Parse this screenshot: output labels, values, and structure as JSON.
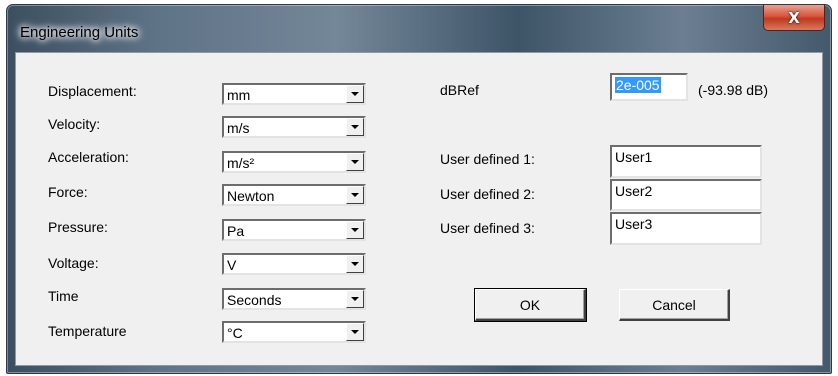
{
  "window": {
    "title": "Engineering Units",
    "close_glyph": "X"
  },
  "units": [
    {
      "label": "Displacement:",
      "value": "mm"
    },
    {
      "label": "Velocity:",
      "value": "m/s"
    },
    {
      "label": "Acceleration:",
      "value": "m/s²"
    },
    {
      "label": "Force:",
      "value": "Newton"
    },
    {
      "label": "Pressure:",
      "value": "Pa"
    },
    {
      "label": "Voltage:",
      "value": "V"
    },
    {
      "label": "Time",
      "value": "Seconds"
    },
    {
      "label": "Temperature",
      "value": "°C"
    }
  ],
  "dbref": {
    "label": "dBRef",
    "value": "2e-005",
    "db_readout": "(-93.98 dB)"
  },
  "user_defined": [
    {
      "label": "User defined 1:",
      "value": "User1"
    },
    {
      "label": "User defined 2:",
      "value": "User2"
    },
    {
      "label": "User defined 3:",
      "value": "User3"
    }
  ],
  "buttons": {
    "ok": "OK",
    "cancel": "Cancel"
  },
  "colors": {
    "selection": "#3399ff",
    "close_button": "#c0391f",
    "dialog_face": "#f0f0f0"
  },
  "icons": {
    "close": "close-icon",
    "dropdown": "chevron-down-icon"
  }
}
